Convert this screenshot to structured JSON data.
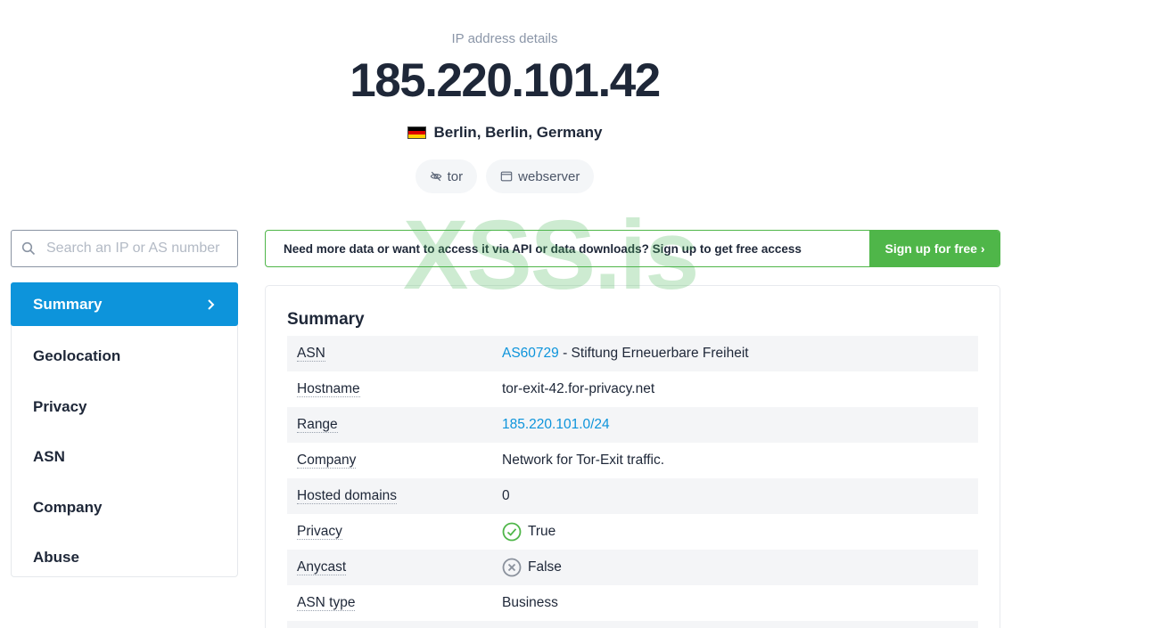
{
  "hero": {
    "kicker": "IP address details",
    "ip": "185.220.101.42",
    "location": "Berlin, Berlin, Germany",
    "flag_colors": [
      "#000000",
      "#dd0000",
      "#ffce00"
    ],
    "tags": [
      {
        "label": "tor",
        "icon": "eye-off-icon"
      },
      {
        "label": "webserver",
        "icon": "browser-window-icon"
      }
    ]
  },
  "search": {
    "placeholder": "Search an IP or AS number",
    "value": ""
  },
  "sidebar": {
    "items": [
      {
        "label": "Summary",
        "active": true
      },
      {
        "label": "Geolocation"
      },
      {
        "label": "Privacy"
      },
      {
        "label": "ASN"
      },
      {
        "label": "Company"
      },
      {
        "label": "Abuse"
      }
    ]
  },
  "banner": {
    "text": "Need more data or want to access it via API or data downloads? Sign up to get free access",
    "button": "Sign up for free ›"
  },
  "summary": {
    "title": "Summary",
    "rows": {
      "asn": {
        "key": "ASN",
        "link": "AS60729",
        "text": " - Stiftung Erneuerbare Freiheit"
      },
      "hostname": {
        "key": "Hostname",
        "value": "tor-exit-42.for-privacy.net"
      },
      "range": {
        "key": "Range",
        "link": "185.220.101.0/24"
      },
      "company": {
        "key": "Company",
        "value": "Network for Tor-Exit traffic."
      },
      "hosted_domains": {
        "key": "Hosted domains",
        "value": "0"
      },
      "privacy": {
        "key": "Privacy",
        "value": "True",
        "icon": "check-circle-icon"
      },
      "anycast": {
        "key": "Anycast",
        "value": "False",
        "icon": "x-circle-icon"
      },
      "asn_type": {
        "key": "ASN type",
        "value": "Business"
      }
    }
  },
  "watermark": "XSS.is",
  "colors": {
    "accent": "#0d94db",
    "success": "#4fb649",
    "text": "#1e2738",
    "muted": "#8b96a8"
  }
}
